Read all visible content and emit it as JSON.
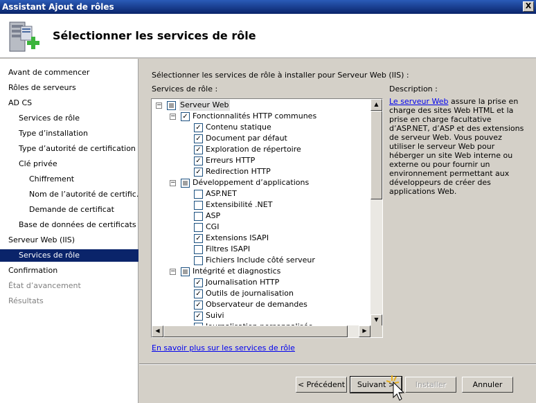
{
  "window": {
    "title": "Assistant Ajout de rôles",
    "close_label": "X"
  },
  "header": {
    "title": "Sélectionner les services de rôle",
    "icon": "server-add-icon"
  },
  "sidebar": {
    "items": [
      {
        "label": "Avant de commencer"
      },
      {
        "label": "Rôles de serveurs"
      },
      {
        "label": "AD CS"
      },
      {
        "label": "Services de rôle"
      },
      {
        "label": "Type d’installation"
      },
      {
        "label": "Type d’autorité de certification"
      },
      {
        "label": "Clé privée"
      },
      {
        "label": "Chiffrement"
      },
      {
        "label": "Nom de l’autorité de certific…"
      },
      {
        "label": "Demande de certificat"
      },
      {
        "label": "Base de données de certificats"
      },
      {
        "label": "Serveur Web (IIS)"
      },
      {
        "label": "Services de rôle"
      },
      {
        "label": "Confirmation"
      },
      {
        "label": "État d’avancement"
      },
      {
        "label": "Résultats"
      }
    ]
  },
  "main": {
    "instruction": "Sélectionner les services de rôle à installer pour Serveur Web (IIS) :",
    "services_label": "Services de rôle :",
    "description_label": "Description :",
    "description_link": "Le serveur Web",
    "description_text": " assure la prise en charge des sites Web HTML et la prise en charge facultative d’ASP.NET, d’ASP et des extensions de serveur Web. Vous pouvez utiliser le serveur Web pour héberger un site Web interne ou externe ou pour fournir un environnement permettant aux développeurs de créer des applications Web.",
    "learn_more_link": "En savoir plus sur les services de rôle"
  },
  "tree": [
    {
      "label": "Serveur Web",
      "level": 0,
      "expander": "−",
      "state": "partial"
    },
    {
      "label": "Fonctionnalités HTTP communes",
      "level": 1,
      "expander": "−",
      "state": "checked"
    },
    {
      "label": "Contenu statique",
      "level": 2,
      "state": "checked"
    },
    {
      "label": "Document par défaut",
      "level": 2,
      "state": "checked"
    },
    {
      "label": "Exploration de répertoire",
      "level": 2,
      "state": "checked"
    },
    {
      "label": "Erreurs HTTP",
      "level": 2,
      "state": "checked"
    },
    {
      "label": "Redirection HTTP",
      "level": 2,
      "state": "checked"
    },
    {
      "label": "Développement d’applications",
      "level": 1,
      "expander": "−",
      "state": "partial"
    },
    {
      "label": "ASP.NET",
      "level": 2,
      "state": "unchecked"
    },
    {
      "label": "Extensibilité .NET",
      "level": 2,
      "state": "unchecked"
    },
    {
      "label": "ASP",
      "level": 2,
      "state": "unchecked"
    },
    {
      "label": "CGI",
      "level": 2,
      "state": "unchecked"
    },
    {
      "label": "Extensions ISAPI",
      "level": 2,
      "state": "checked"
    },
    {
      "label": "Filtres ISAPI",
      "level": 2,
      "state": "unchecked"
    },
    {
      "label": "Fichiers Include côté serveur",
      "level": 2,
      "state": "unchecked"
    },
    {
      "label": "Intégrité et diagnostics",
      "level": 1,
      "expander": "−",
      "state": "partial"
    },
    {
      "label": "Journalisation HTTP",
      "level": 2,
      "state": "checked"
    },
    {
      "label": "Outils de journalisation",
      "level": 2,
      "state": "checked"
    },
    {
      "label": "Observateur de demandes",
      "level": 2,
      "state": "checked"
    },
    {
      "label": "Suivi",
      "level": 2,
      "state": "checked"
    },
    {
      "label": "Journalisation personnalisée",
      "level": 2,
      "state": "unchecked"
    }
  ],
  "buttons": {
    "previous": "< Précédent",
    "next": "Suivant >",
    "install": "Installer",
    "cancel": "Annuler"
  },
  "colors": {
    "selection": "#0a246a",
    "link": "#0000ee"
  }
}
